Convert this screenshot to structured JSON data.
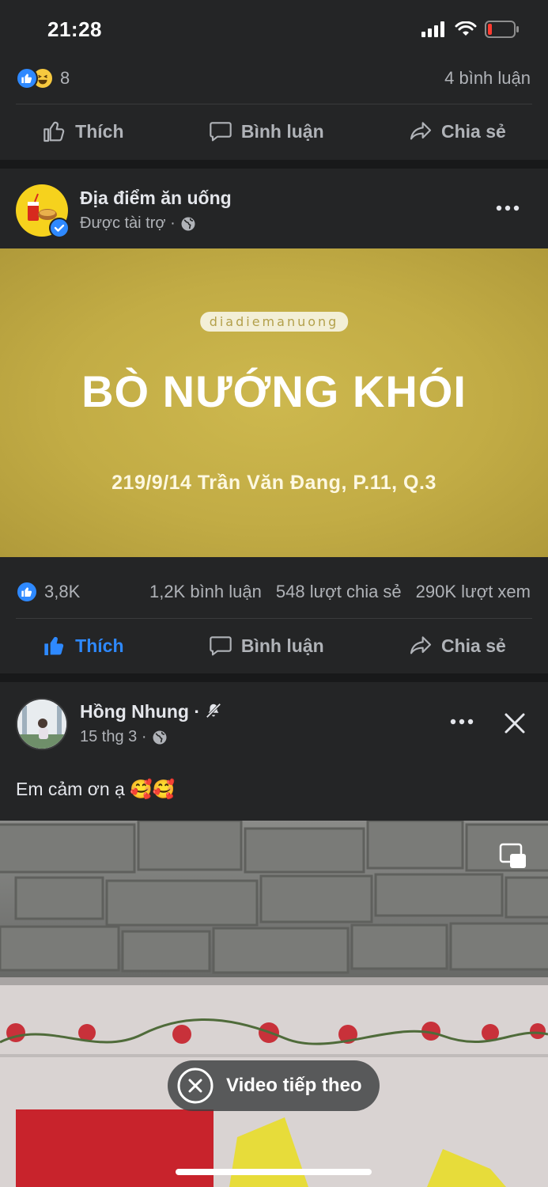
{
  "status_bar": {
    "time": "21:28",
    "battery_level": 0.15
  },
  "post1": {
    "reaction_count": "8",
    "comments": "4 bình luận"
  },
  "actions": {
    "like": "Thích",
    "comment": "Bình luận",
    "share": "Chia sẻ"
  },
  "post2": {
    "page_name": "Địa điểm ăn uống",
    "meta": "Được tài trợ ·",
    "banner": {
      "pill": "diadiemanuong",
      "title": "BÒ NƯỚNG KHÓI",
      "address": "219/9/14 Trần Văn Đang, P.11, Q.3"
    },
    "reaction_count": "3,8K",
    "comments": "1,2K bình luận",
    "shares": "548 lượt chia sẻ",
    "views": "290K lượt xem"
  },
  "post3": {
    "author": "Hồng Nhung",
    "author_suffix": "·",
    "date": "15 thg 3 ·",
    "caption": "Em cảm ơn ạ 🥰🥰",
    "next_video": "Video tiếp theo"
  },
  "colors": {
    "accent": "#2e89ff",
    "card": "#242526",
    "background": "#18191a",
    "banner": "#c2ac45"
  },
  "icons": [
    "signal-icon",
    "wifi-icon",
    "battery-icon",
    "like-reaction-icon",
    "haha-reaction-icon",
    "thumb-up-icon",
    "comment-icon",
    "share-icon",
    "verified-icon",
    "globe-icon",
    "more-icon",
    "close-icon",
    "mute-icon",
    "pip-icon"
  ]
}
